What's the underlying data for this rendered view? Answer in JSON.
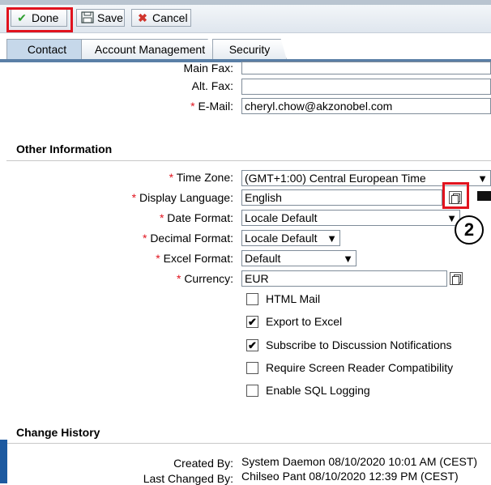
{
  "toolbar": {
    "done_label": "Done",
    "save_label": "Save",
    "cancel_label": "Cancel"
  },
  "tabs": [
    {
      "label": "Contact",
      "active": true
    },
    {
      "label": "Account Management",
      "active": false
    },
    {
      "label": "Security",
      "active": false
    }
  ],
  "contact": {
    "main_fax_label": "Main Fax:",
    "main_fax_value": "",
    "alt_fax_label": "Alt. Fax:",
    "alt_fax_value": "",
    "email_label": "E-Mail:",
    "email_value": "cheryl.chow@akzonobel.com"
  },
  "other_info": {
    "heading": "Other Information",
    "time_zone_label": "Time Zone:",
    "time_zone_value": "(GMT+1:00) Central European Time",
    "display_language_label": "Display Language:",
    "display_language_value": "English",
    "date_format_label": "Date Format:",
    "date_format_value": "Locale Default",
    "decimal_format_label": "Decimal Format:",
    "decimal_format_value": "Locale Default",
    "excel_format_label": "Excel Format:",
    "excel_format_value": "Default",
    "currency_label": "Currency:",
    "currency_value": "EUR",
    "required_marker": "*"
  },
  "options": [
    {
      "label": "HTML Mail",
      "checked": false
    },
    {
      "label": "Export to Excel",
      "checked": true
    },
    {
      "label": "Subscribe to Discussion Notifications",
      "checked": true
    },
    {
      "label": "Require Screen Reader Compatibility",
      "checked": false
    },
    {
      "label": "Enable SQL Logging",
      "checked": false
    }
  ],
  "change_history": {
    "heading": "Change History",
    "created_by_label": "Created By:",
    "created_by_value": "System Daemon  08/10/2020 10:01 AM (CEST)",
    "last_changed_by_label": "Last Changed By:",
    "last_changed_by_value": "Chilseo Pant  08/10/2020 12:39 PM (CEST)"
  },
  "annotation": {
    "step_number": "2"
  },
  "colors": {
    "highlight": "#e1131e",
    "required": "#e1131e",
    "tab_active": "#c6d8ea",
    "accent": "#1d5aa0"
  },
  "icons": {
    "done": "check-icon",
    "save": "floppy-disk-icon",
    "cancel": "x-icon",
    "picker": "lookup-icon",
    "dropdown": "chevron-down-icon"
  }
}
